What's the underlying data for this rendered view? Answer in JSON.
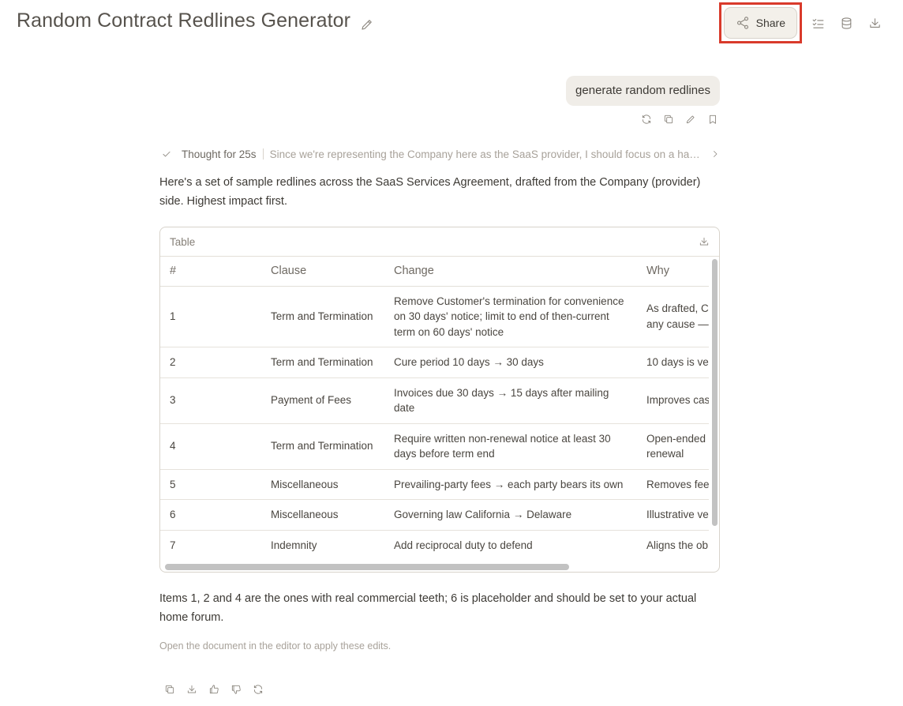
{
  "header": {
    "title": "Random Contract Redlines Generator",
    "share_label": "Share",
    "icons": [
      "pencil-icon",
      "share-icon",
      "checklist-icon",
      "database-icon",
      "download-icon"
    ]
  },
  "user_message": {
    "text": "generate random redlines",
    "actions": [
      "refresh-icon",
      "copy-icon",
      "edit-icon",
      "bookmark-icon"
    ]
  },
  "thought": {
    "label": "Thought for 25s",
    "preview": "Since we're representing the Company here as the SaaS provider, I should focus on a han..."
  },
  "response": {
    "intro": "Here's a set of sample redlines across the SaaS Services Agreement, drafted from the Company (provider) side. Highest impact first.",
    "table": {
      "title": "Table",
      "columns": [
        "#",
        "Clause",
        "Change",
        "Why"
      ],
      "rows": [
        {
          "num": "1",
          "clause": "Term and Termination",
          "change": "Remove Customer's termination for convenience on 30 days' notice; limit to end of then-current term on 60 days' notice",
          "why": "As drafted, C\nany cause —"
        },
        {
          "num": "2",
          "clause": "Term and Termination",
          "change": "Cure period 10 days → 30 days",
          "why": "10 days is ver"
        },
        {
          "num": "3",
          "clause": "Payment of Fees",
          "change": "Invoices due 30 days → 15 days after mailing date",
          "why": "Improves cas"
        },
        {
          "num": "4",
          "clause": "Term and Termination",
          "change": "Require written non-renewal notice at least 30 days before term end",
          "why": "Open-ended\nrenewal"
        },
        {
          "num": "5",
          "clause": "Miscellaneous",
          "change": "Prevailing-party fees → each party bears its own",
          "why": "Removes fee"
        },
        {
          "num": "6",
          "clause": "Miscellaneous",
          "change": "Governing law California → Delaware",
          "why": "Illustrative ve"
        },
        {
          "num": "7",
          "clause": "Indemnity",
          "change": "Add reciprocal duty to defend",
          "why": "Aligns the ob"
        }
      ]
    },
    "after": "Items 1, 2 and 4 are the ones with real commercial teeth; 6 is placeholder and should be set to your actual home forum.",
    "editor_hint": "Open the document in the editor to apply these edits.",
    "actions": [
      "copy-icon",
      "download-icon",
      "thumbs-up-icon",
      "thumbs-down-icon",
      "regenerate-icon"
    ]
  }
}
